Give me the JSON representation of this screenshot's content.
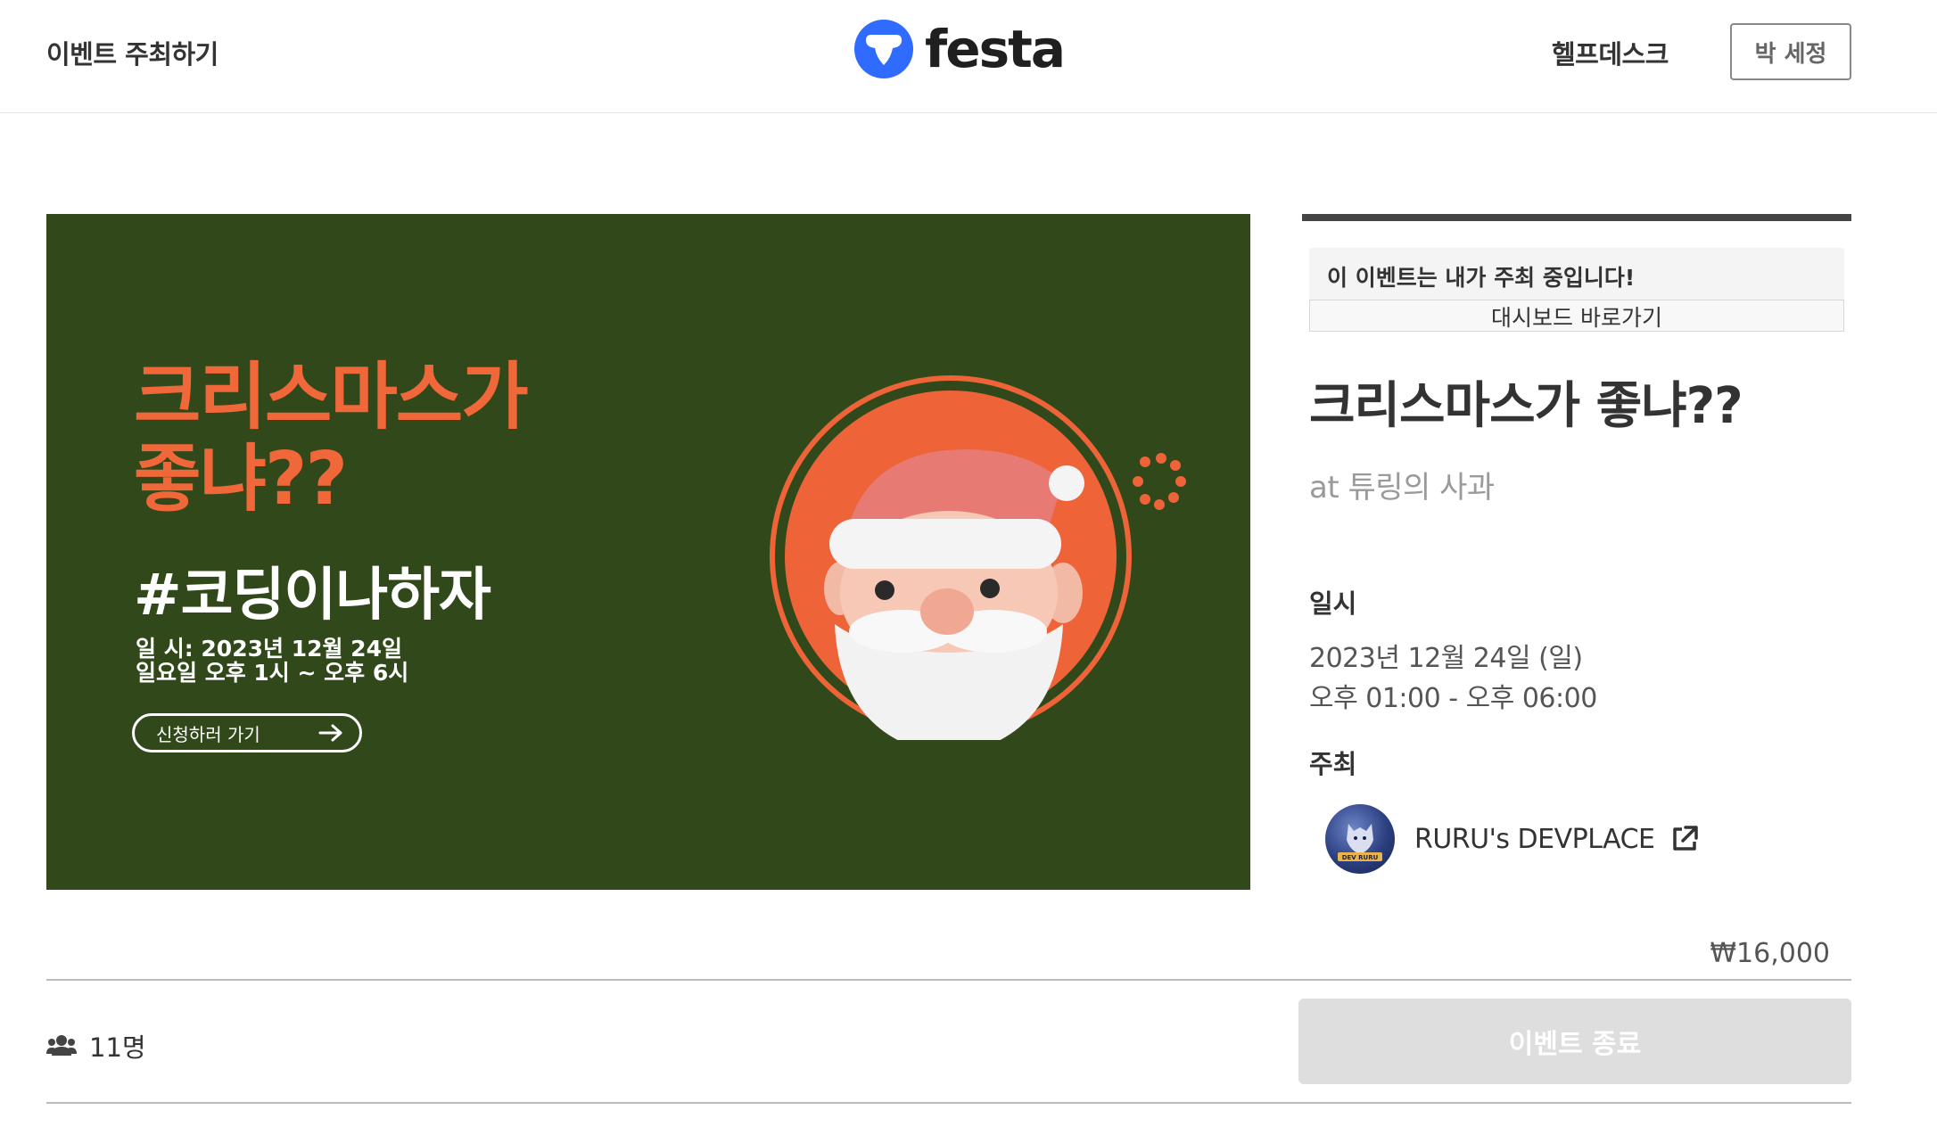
{
  "header": {
    "host_event_link": "이벤트 주최하기",
    "logo_text": "festa",
    "helpdesk_link": "헬프데스크",
    "user_name": "박 세정"
  },
  "banner": {
    "title": "크리스마스가\n좋냐??",
    "hashtag": "#코딩이나하자",
    "date_line1": "일 시: 2023년 12월 24일",
    "date_line2": "일요일 오후 1시 ~ 오후 6시",
    "cta": "신청하러 가기"
  },
  "sidebar": {
    "host_notice": "이 이벤트는 내가 주최 중입니다!",
    "dashboard_button": "대시보드 바로가기",
    "event_title": "크리스마스가 좋냐??",
    "venue": "at 튜링의 사과",
    "date_label": "일시",
    "date": "2023년 12월 24일 (일)",
    "time": "오후 01:00 - 오후 06:00",
    "host_label": "주최",
    "host_name": "RURU's DEVPLACE",
    "host_avatar_text": "DEV RURU"
  },
  "footer": {
    "price": "₩16,000",
    "attendee_count": "11명",
    "end_button": "이벤트 종료"
  },
  "colors": {
    "brand_blue": "#2f6bff",
    "banner_bg": "#31491a",
    "banner_title": "#f0673a",
    "santa_circle": "#ee6338"
  },
  "icons": [
    "festa-logo-icon",
    "arrow-right-icon",
    "external-link-icon",
    "people-icon"
  ]
}
